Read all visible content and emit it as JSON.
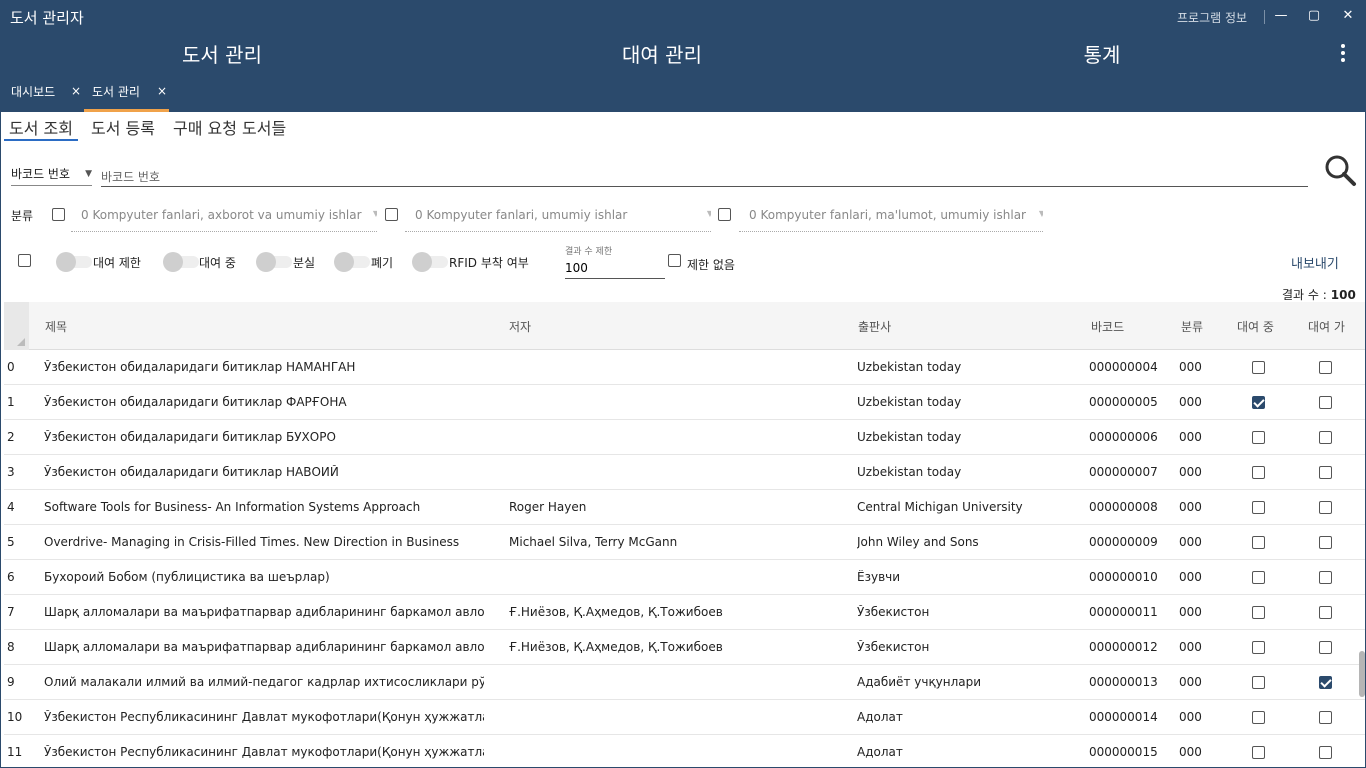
{
  "window": {
    "title": "도서 관리자",
    "info_link": "프로그램 정보",
    "minimize": "—",
    "maximize": "▢",
    "close": "✕"
  },
  "nav": {
    "menus": [
      "도서 관리",
      "대여 관리",
      "통계"
    ]
  },
  "tabs": [
    {
      "label": "대시보드",
      "close": "×"
    },
    {
      "label": "도서 관리",
      "close": "×"
    }
  ],
  "subtabs": [
    "도서 조회",
    "도서 등록",
    "구매 요청 도서들"
  ],
  "search": {
    "field_select": "바코드 번호",
    "placeholder": "바코드 번호",
    "value": ""
  },
  "category": {
    "label": "분류",
    "selects": [
      {
        "text": "0 Kompyuter fanlari, axborot va umumiy ishlar",
        "checked": false
      },
      {
        "text": "0 Kompyuter fanlari, umumiy ishlar",
        "checked": false
      },
      {
        "text": "0 Kompyuter fanlari, ma'lumot, umumiy ishlar",
        "checked": false
      }
    ]
  },
  "filters": {
    "toggles": [
      "대여 제한",
      "대여 중",
      "분실",
      "폐기",
      "RFID 부착 여부"
    ],
    "limit_caption": "결과 수 제한",
    "limit_value": "100",
    "no_limit": "제한 없음",
    "export": "내보내기"
  },
  "result": {
    "label": "결과 수 :",
    "count": "100"
  },
  "table": {
    "headers": [
      "제목",
      "저자",
      "출판사",
      "바코드",
      "분류",
      "대여 중",
      "대여 가"
    ],
    "rows": [
      {
        "idx": "0",
        "title": "Ўзбекистон обидаларидаги битиклар НАМАНГАН",
        "author": "",
        "publisher": "Uzbekistan today",
        "barcode": "000000004",
        "category": "000",
        "on_loan": false,
        "loan_restricted": false
      },
      {
        "idx": "1",
        "title": "Ўзбекистон обидаларидаги битиклар ФАРҒОНА",
        "author": "",
        "publisher": "Uzbekistan today",
        "barcode": "000000005",
        "category": "000",
        "on_loan": true,
        "loan_restricted": false
      },
      {
        "idx": "2",
        "title": "Ўзбекистон обидаларидаги битиклар БУХОРО",
        "author": "",
        "publisher": "Uzbekistan today",
        "barcode": "000000006",
        "category": "000",
        "on_loan": false,
        "loan_restricted": false
      },
      {
        "idx": "3",
        "title": "Ўзбекистон обидаларидаги битиклар НАВОИЙ",
        "author": "",
        "publisher": "Uzbekistan today",
        "barcode": "000000007",
        "category": "000",
        "on_loan": false,
        "loan_restricted": false
      },
      {
        "idx": "4",
        "title": "Software Tools for Business- An Information Systems Approach",
        "author": "Roger Hayen",
        "publisher": "Central Michigan University",
        "barcode": "000000008",
        "category": "000",
        "on_loan": false,
        "loan_restricted": false
      },
      {
        "idx": "5",
        "title": "Overdrive- Managing in Crisis-Filled Times. New Direction in Business",
        "author": "Michael Silva, Terry McGann",
        "publisher": "John Wiley and Sons",
        "barcode": "000000009",
        "category": "000",
        "on_loan": false,
        "loan_restricted": false
      },
      {
        "idx": "6",
        "title": "Бухороий Бобом (публицистика ва шеърлар)",
        "author": "",
        "publisher": "Ёзувчи",
        "barcode": "000000010",
        "category": "000",
        "on_loan": false,
        "loan_restricted": false
      },
      {
        "idx": "7",
        "title": "Шарқ алломалари ва маърифатпарвар адибларининг баркамол авлод",
        "author": "Ғ.Ниёзов, Қ.Аҳмедов, Қ.Тожибоев",
        "publisher": "Ўзбекистон",
        "barcode": "000000011",
        "category": "000",
        "on_loan": false,
        "loan_restricted": false
      },
      {
        "idx": "8",
        "title": "Шарқ алломалари ва маърифатпарвар адибларининг баркамол авлод",
        "author": "Ғ.Ниёзов, Қ.Аҳмедов, Қ.Тожибоев",
        "publisher": "Ўзбекистон",
        "barcode": "000000012",
        "category": "000",
        "on_loan": false,
        "loan_restricted": false
      },
      {
        "idx": "9",
        "title": "Олий малакали илмий ва илмий-педагог кадрлар ихтисосликлари рўйх",
        "author": "",
        "publisher": "Адабиёт учқунлари",
        "barcode": "000000013",
        "category": "000",
        "on_loan": false,
        "loan_restricted": true
      },
      {
        "idx": "10",
        "title": "Ўзбекистон Республикасининг Давлат мукофотлари(Қонун ҳужжатлари)",
        "author": "",
        "publisher": "Адолат",
        "barcode": "000000014",
        "category": "000",
        "on_loan": false,
        "loan_restricted": false
      },
      {
        "idx": "11",
        "title": "Ўзбекистон Республикасининг Давлат мукофотлари(Қонун ҳужжатлари)",
        "author": "",
        "publisher": "Адолат",
        "barcode": "000000015",
        "category": "000",
        "on_loan": false,
        "loan_restricted": false
      }
    ]
  },
  "icons": {
    "search": "search-icon",
    "more": "more-vert-icon",
    "sort": "sort-corner-icon"
  }
}
